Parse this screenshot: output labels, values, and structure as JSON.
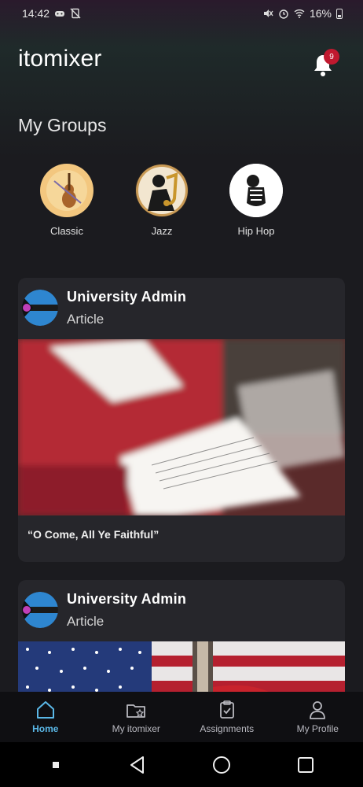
{
  "status": {
    "time": "14:42",
    "battery": "16%"
  },
  "header": {
    "title": "itomixer",
    "notification_count": "9"
  },
  "groups": {
    "title": "My Groups",
    "items": [
      {
        "label": "Classic",
        "icon": "violin-icon"
      },
      {
        "label": "Jazz",
        "icon": "saxophone-icon"
      },
      {
        "label": "Hip Hop",
        "icon": "microphone-icon"
      }
    ]
  },
  "feed": [
    {
      "author": "University  Admin",
      "type": "Article",
      "caption": "“O Come, All Ye Faithful”"
    },
    {
      "author": "University  Admin",
      "type": "Article",
      "caption": ""
    }
  ],
  "nav": {
    "items": [
      {
        "label": "Home",
        "icon": "home-icon",
        "active": true
      },
      {
        "label": "My itomixer",
        "icon": "folder-star-icon",
        "active": false
      },
      {
        "label": "Assignments",
        "icon": "clipboard-check-icon",
        "active": false
      },
      {
        "label": "My Profile",
        "icon": "user-icon",
        "active": false
      }
    ]
  },
  "colors": {
    "accent": "#5ab7e6",
    "badge": "#c0192f",
    "card_bg": "#26262b",
    "background": "#1b1b1f"
  }
}
